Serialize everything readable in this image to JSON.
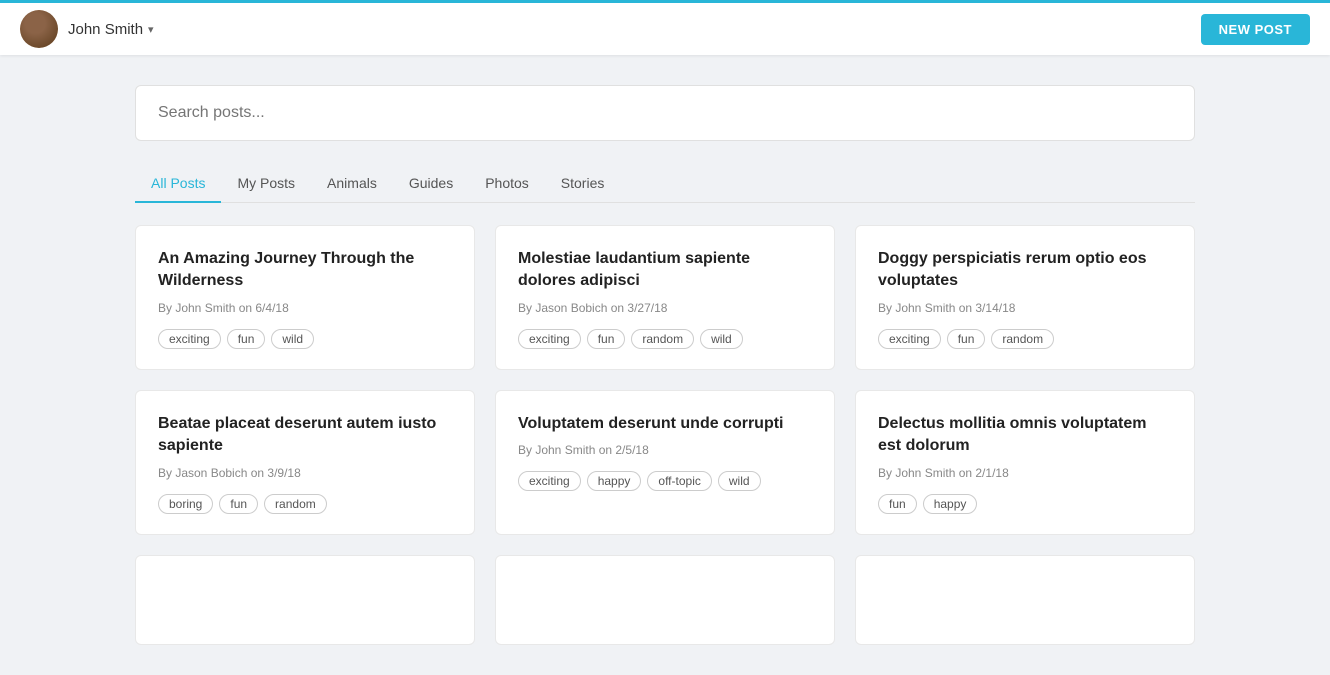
{
  "header": {
    "username": "John Smith",
    "new_post_label": "NEW POST"
  },
  "search": {
    "placeholder": "Search posts..."
  },
  "tabs": [
    {
      "id": "all-posts",
      "label": "All Posts",
      "active": true
    },
    {
      "id": "my-posts",
      "label": "My Posts",
      "active": false
    },
    {
      "id": "animals",
      "label": "Animals",
      "active": false
    },
    {
      "id": "guides",
      "label": "Guides",
      "active": false
    },
    {
      "id": "photos",
      "label": "Photos",
      "active": false
    },
    {
      "id": "stories",
      "label": "Stories",
      "active": false
    }
  ],
  "posts": [
    {
      "title": "An Amazing Journey Through the Wilderness",
      "meta": "By John Smith on 6/4/18",
      "tags": [
        "exciting",
        "fun",
        "wild"
      ]
    },
    {
      "title": "Molestiae laudantium sapiente dolores adipisci",
      "meta": "By Jason Bobich on 3/27/18",
      "tags": [
        "exciting",
        "fun",
        "random",
        "wild"
      ]
    },
    {
      "title": "Doggy perspiciatis rerum optio eos voluptates",
      "meta": "By John Smith on 3/14/18",
      "tags": [
        "exciting",
        "fun",
        "random"
      ]
    },
    {
      "title": "Beatae placeat deserunt autem iusto sapiente",
      "meta": "By Jason Bobich on 3/9/18",
      "tags": [
        "boring",
        "fun",
        "random"
      ]
    },
    {
      "title": "Voluptatem deserunt unde corrupti",
      "meta": "By John Smith on 2/5/18",
      "tags": [
        "exciting",
        "happy",
        "off-topic",
        "wild"
      ]
    },
    {
      "title": "Delectus mollitia omnis voluptatem est dolorum",
      "meta": "By John Smith on 2/1/18",
      "tags": [
        "fun",
        "happy"
      ]
    }
  ]
}
